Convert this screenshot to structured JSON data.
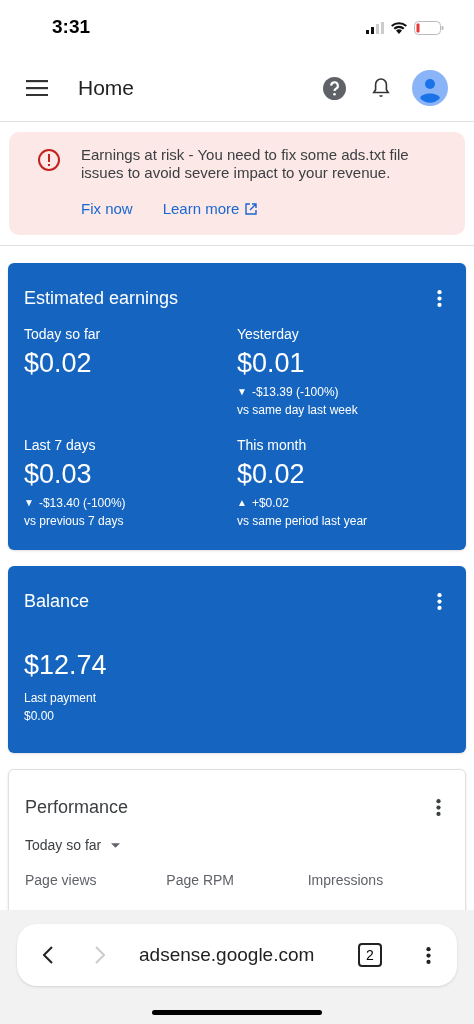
{
  "status_bar": {
    "time": "3:31"
  },
  "header": {
    "title": "Home"
  },
  "alert": {
    "message": "Earnings at risk - You need to fix some ads.txt file issues to avoid severe impact to your revenue.",
    "actions": [
      {
        "label": "Fix now",
        "external": false
      },
      {
        "label": "Learn more",
        "external": true
      }
    ]
  },
  "earnings": {
    "title": "Estimated earnings",
    "metrics": [
      {
        "label": "Today so far",
        "value": "$0.02"
      },
      {
        "label": "Yesterday",
        "value": "$0.01",
        "change": {
          "arrow": "▼",
          "text": "-$13.39 (-100%)"
        },
        "comparison": "vs same day last week"
      },
      {
        "label": "Last 7 days",
        "value": "$0.03",
        "change": {
          "arrow": "▼",
          "text": "-$13.40 (-100%)"
        },
        "comparison": "vs previous 7 days"
      },
      {
        "label": "This month",
        "value": "$0.02",
        "change": {
          "arrow": "▲",
          "text": "+$0.02"
        },
        "comparison": "vs same period last year"
      }
    ]
  },
  "balance": {
    "title": "Balance",
    "value": "$12.74",
    "last_payment_label": "Last payment",
    "last_payment_value": "$0.00"
  },
  "performance": {
    "title": "Performance",
    "period": "Today so far",
    "columns": [
      "Page views",
      "Page RPM",
      "Impressions"
    ]
  },
  "browser_bar": {
    "url": "adsense.google.com",
    "tab_count": "2"
  }
}
